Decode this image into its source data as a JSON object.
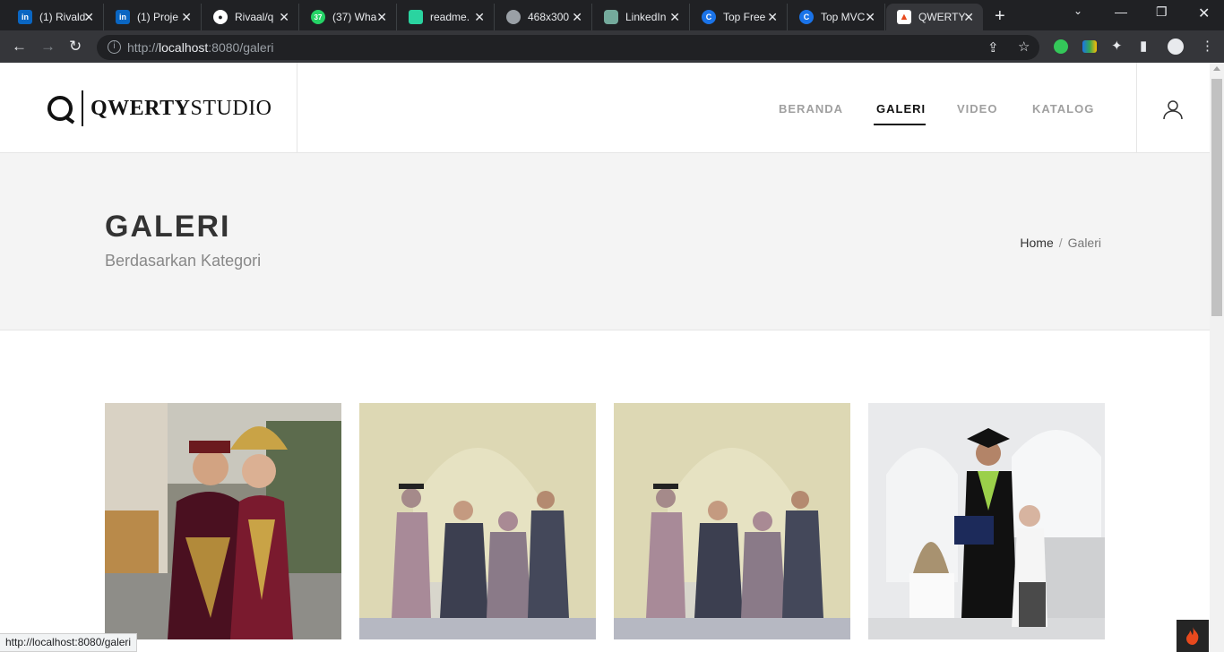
{
  "browser": {
    "tabs": [
      {
        "title": "(1) Rivald",
        "favicon": "linkedin-icon",
        "color": "#0a66c2"
      },
      {
        "title": "(1) Proje",
        "favicon": "linkedin-icon",
        "color": "#0a66c2"
      },
      {
        "title": "Rivaal/q",
        "favicon": "github-icon",
        "color": "#ffffff"
      },
      {
        "title": "(37) Wha",
        "favicon": "whatsapp-icon",
        "color": "#25d366"
      },
      {
        "title": "readme.",
        "favicon": "readme-icon",
        "color": "#2ad4a0"
      },
      {
        "title": "468x300",
        "favicon": "globe-icon",
        "color": "#9aa0a6"
      },
      {
        "title": "LinkedIn",
        "favicon": "chatgpt-icon",
        "color": "#74aa9c"
      },
      {
        "title": "Top Free",
        "favicon": "c-icon",
        "color": "#1a73e8"
      },
      {
        "title": "Top MVC",
        "favicon": "c-icon",
        "color": "#1a73e8"
      },
      {
        "title": "QWERTY",
        "favicon": "flame-icon",
        "color": "#e8491d"
      }
    ],
    "url_prefix": "http://",
    "url_host": "localhost",
    "url_rest": ":8080/galeri",
    "status_url": "http://localhost:8080/galeri"
  },
  "site": {
    "logo_bold": "QWERTY",
    "logo_light": "STUDIO",
    "nav": [
      "BERANDA",
      "GALERI",
      "VIDEO",
      "KATALOG"
    ],
    "active_nav": "GALERI"
  },
  "hero": {
    "title": "GALERI",
    "subtitle": "Berdasarkan Kategori",
    "breadcrumb_home": "Home",
    "breadcrumb_sep": "/",
    "breadcrumb_current": "Galeri"
  },
  "gallery": {
    "photos": [
      {
        "subject": "wedding-couple-traditional"
      },
      {
        "subject": "family-graduation-portrait"
      },
      {
        "subject": "family-graduation-portrait"
      },
      {
        "subject": "graduation-portrait-couple"
      }
    ]
  }
}
